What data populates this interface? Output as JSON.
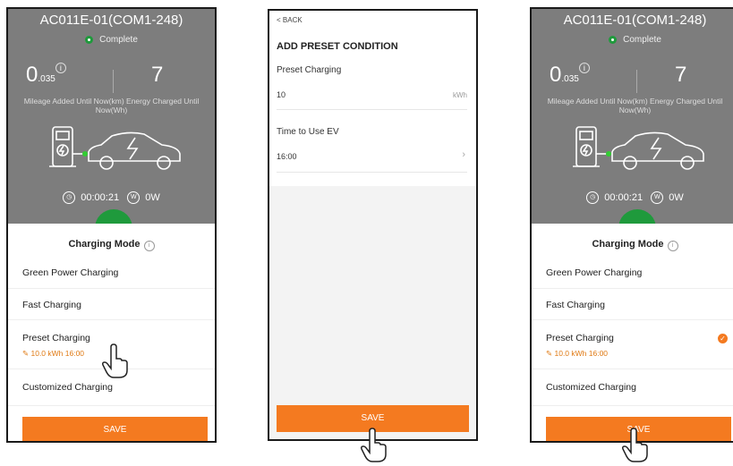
{
  "device": {
    "title": "AC011E-01(COM1-248)",
    "status": "Complete",
    "mileage_value": "0",
    "mileage_decimals": ".035",
    "energy_value": "7",
    "mileage_label": "Mileage Added Until Now(km)",
    "energy_label": "Energy Charged Until Now(Wh)",
    "duration": "00:00:21",
    "power": "0W",
    "info_glyph": "i",
    "watt_glyph": "W"
  },
  "sheet": {
    "title": "Charging Mode",
    "options": [
      {
        "label": "Green Power Charging"
      },
      {
        "label": "Fast Charging"
      },
      {
        "label": "Preset Charging",
        "sub": "10.0 kWh  16:00"
      },
      {
        "label": "Customized Charging"
      }
    ],
    "save": "SAVE"
  },
  "preset_screen": {
    "back": "BACK",
    "title": "ADD PRESET CONDITION",
    "preset_label": "Preset Charging",
    "preset_value": "10",
    "preset_unit": "kWh",
    "time_label": "Time to Use EV",
    "time_value": "16:00",
    "save": "SAVE"
  },
  "colors": {
    "accent": "#f47a20",
    "status_green": "#1f9a3c",
    "dim": "#7d7d7d"
  },
  "icons": [
    "info-icon",
    "clock-icon",
    "power-icon",
    "charger-icon",
    "car-icon",
    "edit-icon",
    "check-icon",
    "chevron-right-icon",
    "hand-pointer-icon"
  ]
}
